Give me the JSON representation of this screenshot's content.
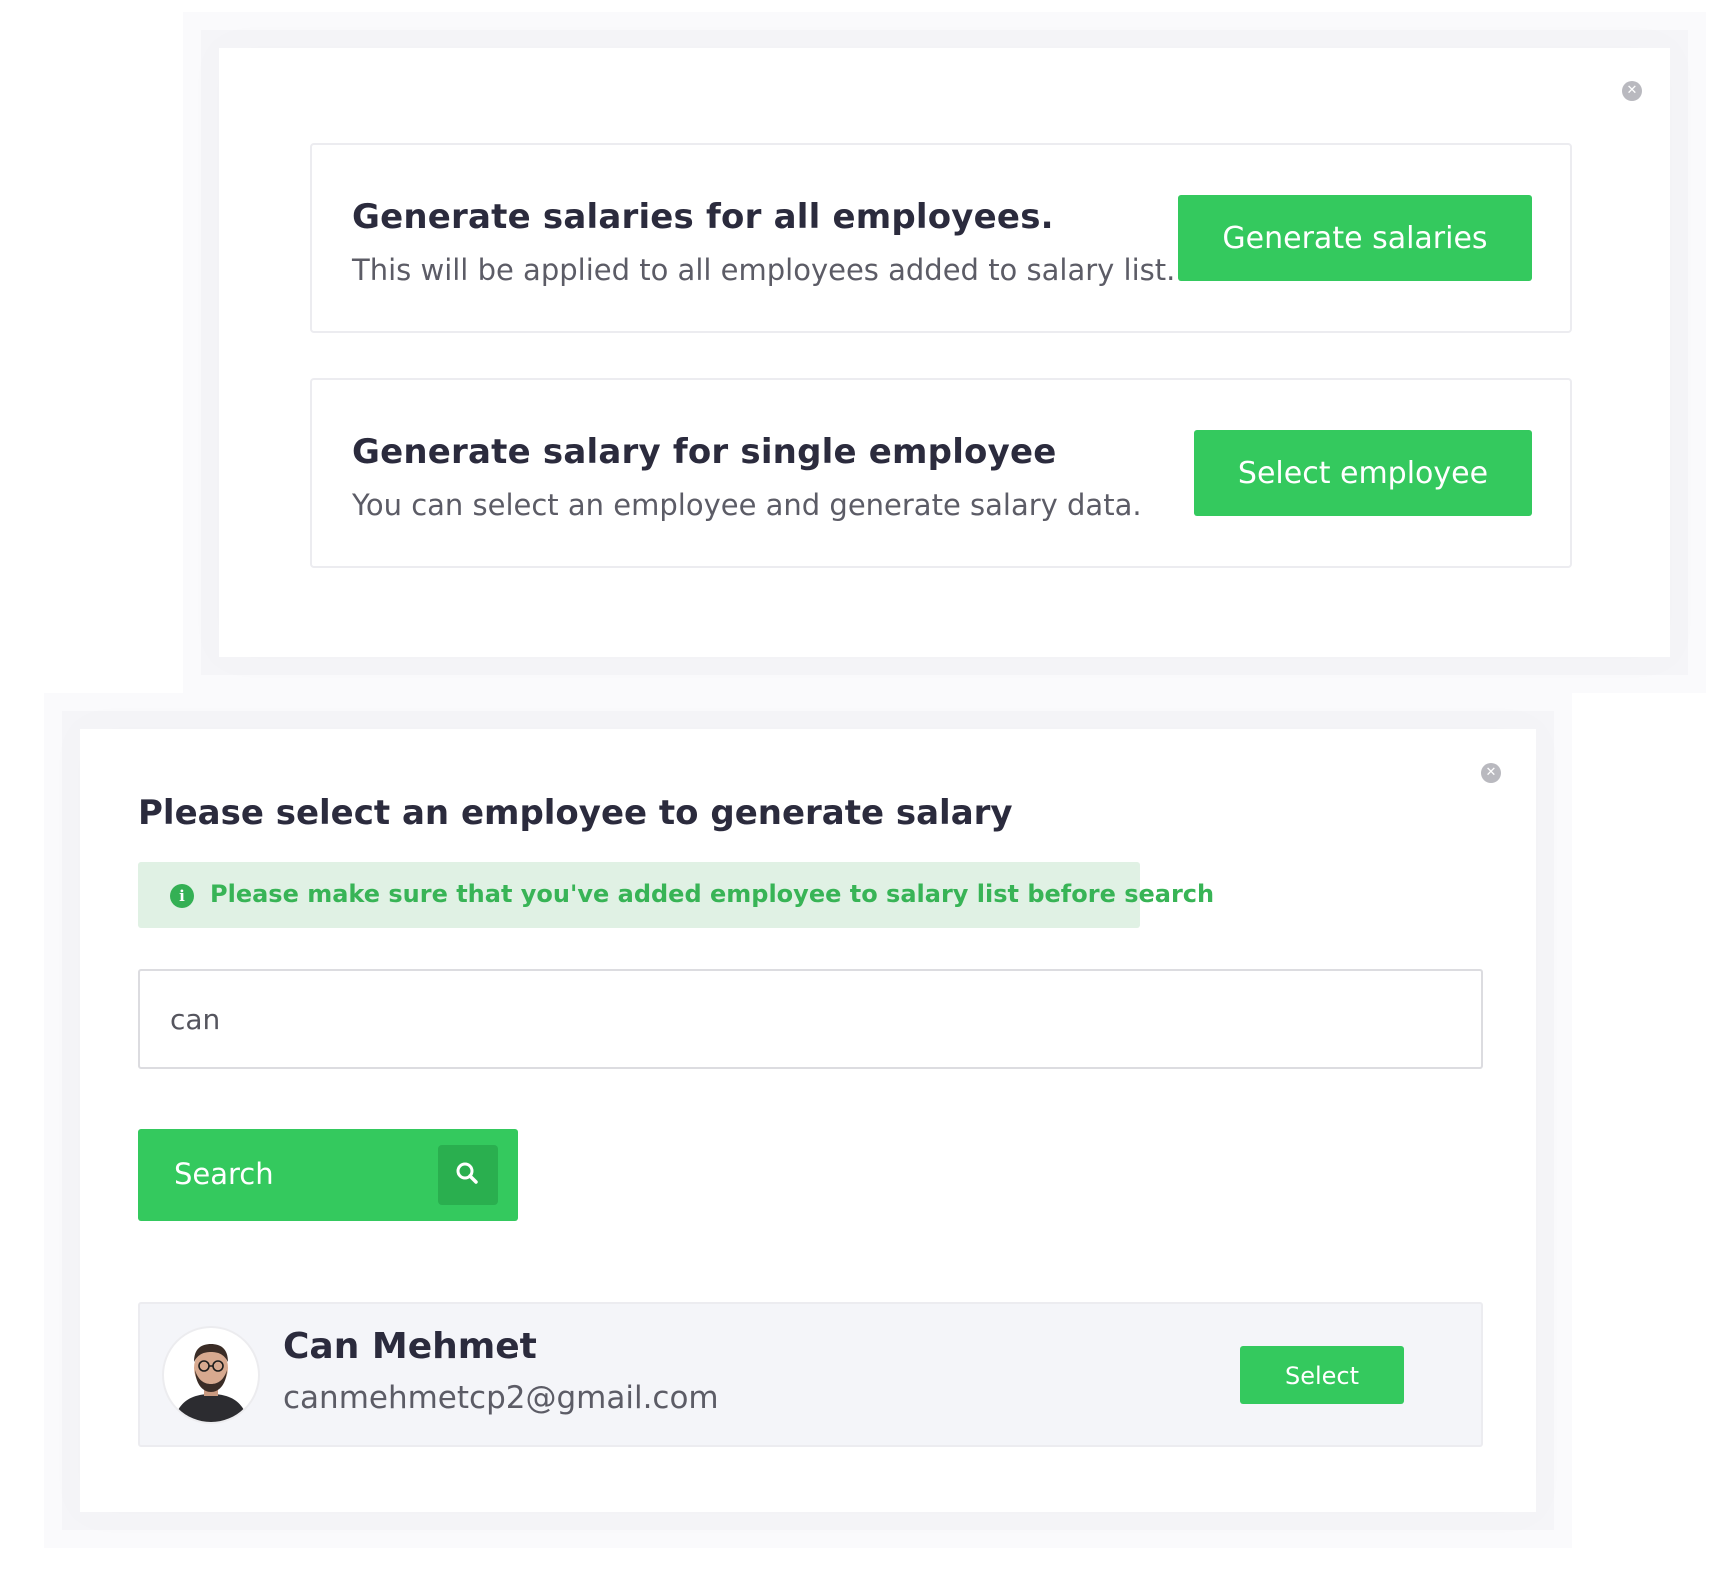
{
  "generate_modal": {
    "close_icon": "close-icon",
    "all_employees": {
      "title": "Generate salaries for all employees.",
      "description": "This will be applied to all employees added to salary list.",
      "button_label": "Generate salaries"
    },
    "single_employee": {
      "title": "Generate salary for single employee",
      "description": "You can select an employee and generate salary data.",
      "button_label": "Select employee"
    }
  },
  "select_modal": {
    "close_icon": "close-icon",
    "heading": "Please select an employee to generate salary",
    "notice": {
      "icon": "info-icon",
      "text": "Please make sure that you've added employee to salary list before search"
    },
    "search": {
      "value": "can",
      "button_label": "Search",
      "button_icon": "search-icon"
    },
    "results": [
      {
        "name": "Can Mehmet",
        "email": "canmehmetcp2@gmail.com",
        "select_label": "Select"
      }
    ]
  },
  "colors": {
    "accent": "#34c95e",
    "notice_background": "#e0f1e4",
    "notice_text": "#38b456"
  }
}
